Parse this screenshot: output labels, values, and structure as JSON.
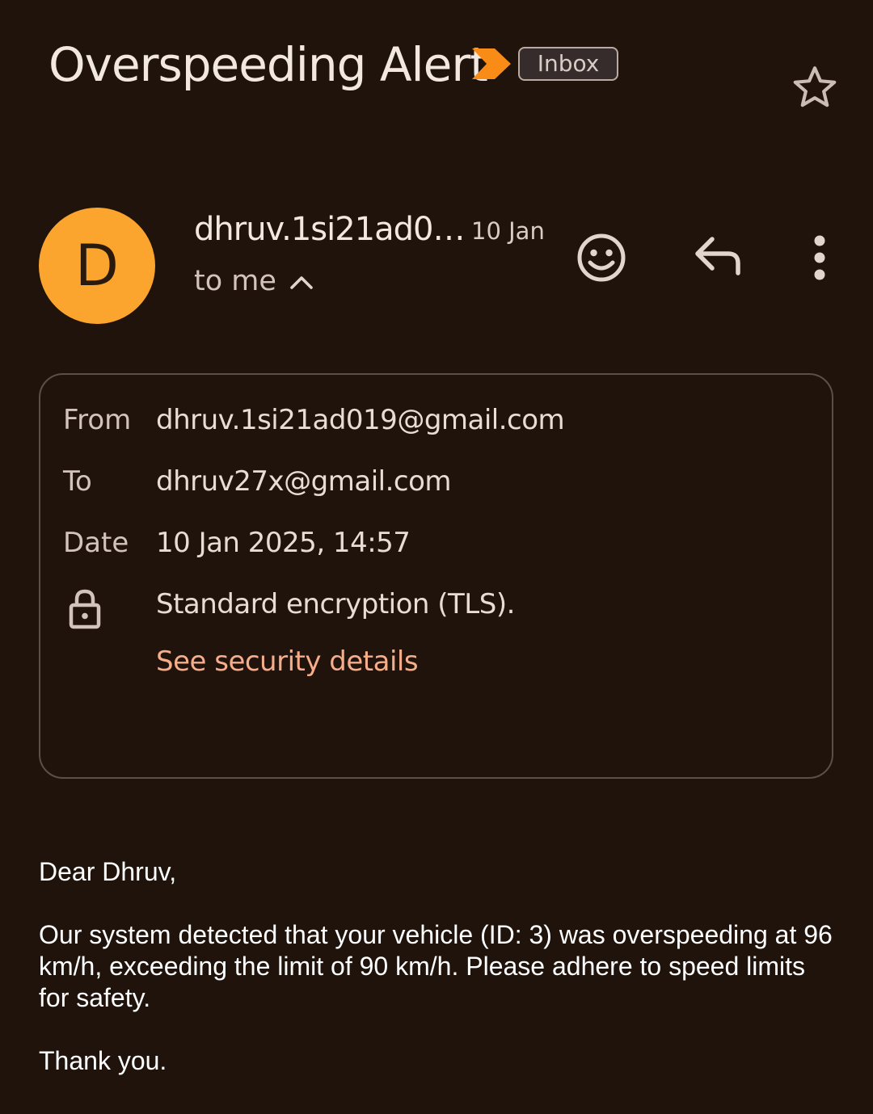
{
  "email": {
    "subject": "Overspeeding Alert",
    "label_chip": "Inbox",
    "sender": {
      "avatar_initial": "D",
      "name_truncated": "dhruv.1si21ad0…",
      "date_short": "10 Jan",
      "recipient_summary": "to me"
    },
    "details": {
      "from_label": "From",
      "from_value": "dhruv.1si21ad019@gmail.com",
      "to_label": "To",
      "to_value": "dhruv27x@gmail.com",
      "date_label": "Date",
      "date_value": "10 Jan 2025, 14:57",
      "encryption_text": "Standard encryption (TLS).",
      "security_link": "See security details"
    },
    "body": {
      "greeting": "Dear Dhruv,",
      "message": "Our system detected that your vehicle (ID: 3) was overspeeding at 96 km/h, exceeding the limit of 90 km/h. Please adhere to speed limits for safety.",
      "closing": "Thank you."
    }
  },
  "icons": {
    "important": "important-marker-icon",
    "star": "star-outline-icon",
    "expand": "chevron-up-icon",
    "emoji": "add-emoji-reaction-icon",
    "reply": "reply-icon",
    "more": "more-vertical-icon",
    "lock": "lock-icon"
  },
  "colors": {
    "background": "#1f130c",
    "avatar": "#fba52e",
    "important_marker": "#f98c16",
    "link": "#f6ad8a"
  }
}
